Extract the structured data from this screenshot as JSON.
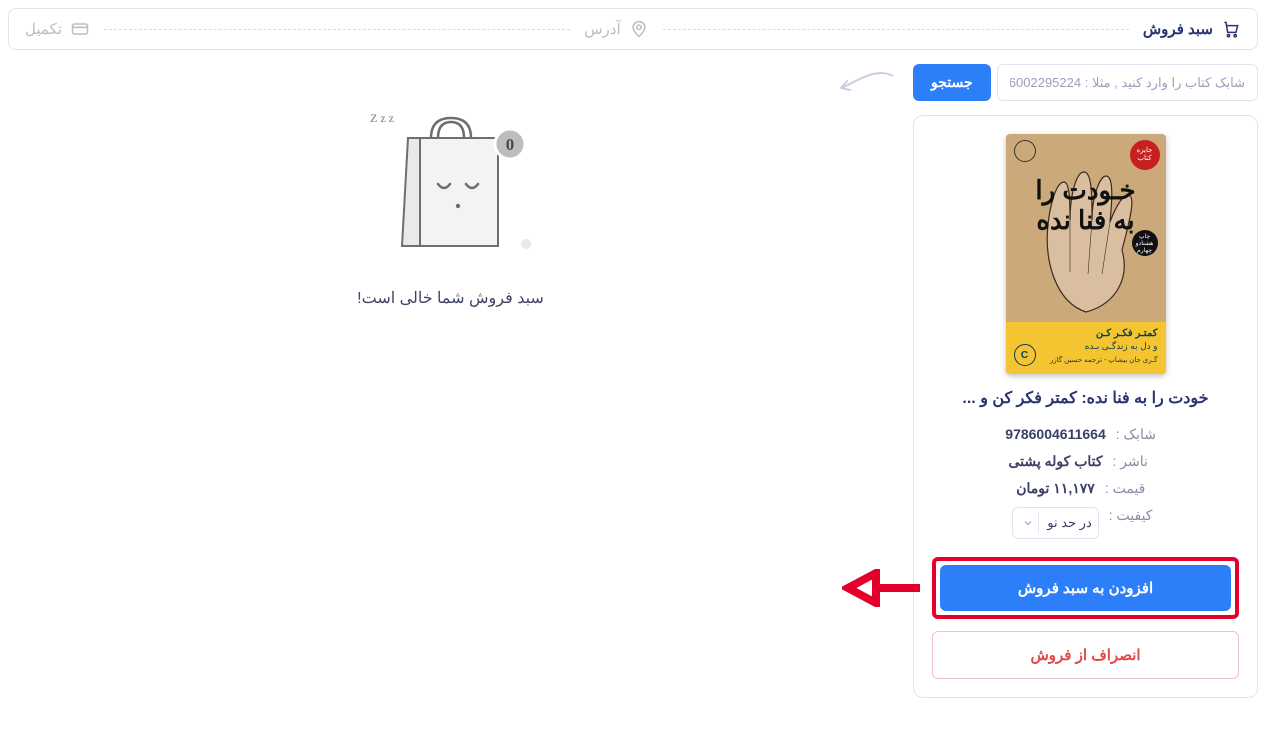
{
  "steps": {
    "basket": {
      "label": "سبد فروش"
    },
    "address": {
      "label": "آدرس"
    },
    "complete": {
      "label": "تکمیل"
    }
  },
  "search": {
    "placeholder": "شابک کتاب را وارد کنید , مثلا : 9786002295224",
    "button": "جستجو"
  },
  "book": {
    "cover": {
      "title_line1": "خـودت را",
      "title_line2": "به فنا نده",
      "sub1": "کمتـر فکـر کـن",
      "sub2": "و دل به زندگـی بـده",
      "author": "گـری جان بیشاپ - ترجمه حسین گازر",
      "ribbon": "جایزه کتاب",
      "stamp": "چاپ هشتادو چهارم"
    },
    "title": "خودت را به فنا نده: کمتر فکر کن و ...",
    "isbn_label": "شابک :",
    "isbn_value": "9786004611664",
    "publisher_label": "ناشر :",
    "publisher_value": "کتاب کوله پشتی",
    "price_label": "قیمت :",
    "price_value": "۱۱,۱۷۷ تومان",
    "quality_label": "کیفیت :",
    "quality_value": "در حد نو"
  },
  "actions": {
    "add": "افزودن به سبد فروش",
    "cancel": "انصراف از فروش"
  },
  "basket": {
    "count": "0",
    "empty": "سبد فروش شما خالی است!",
    "zzz": "Z z z"
  }
}
